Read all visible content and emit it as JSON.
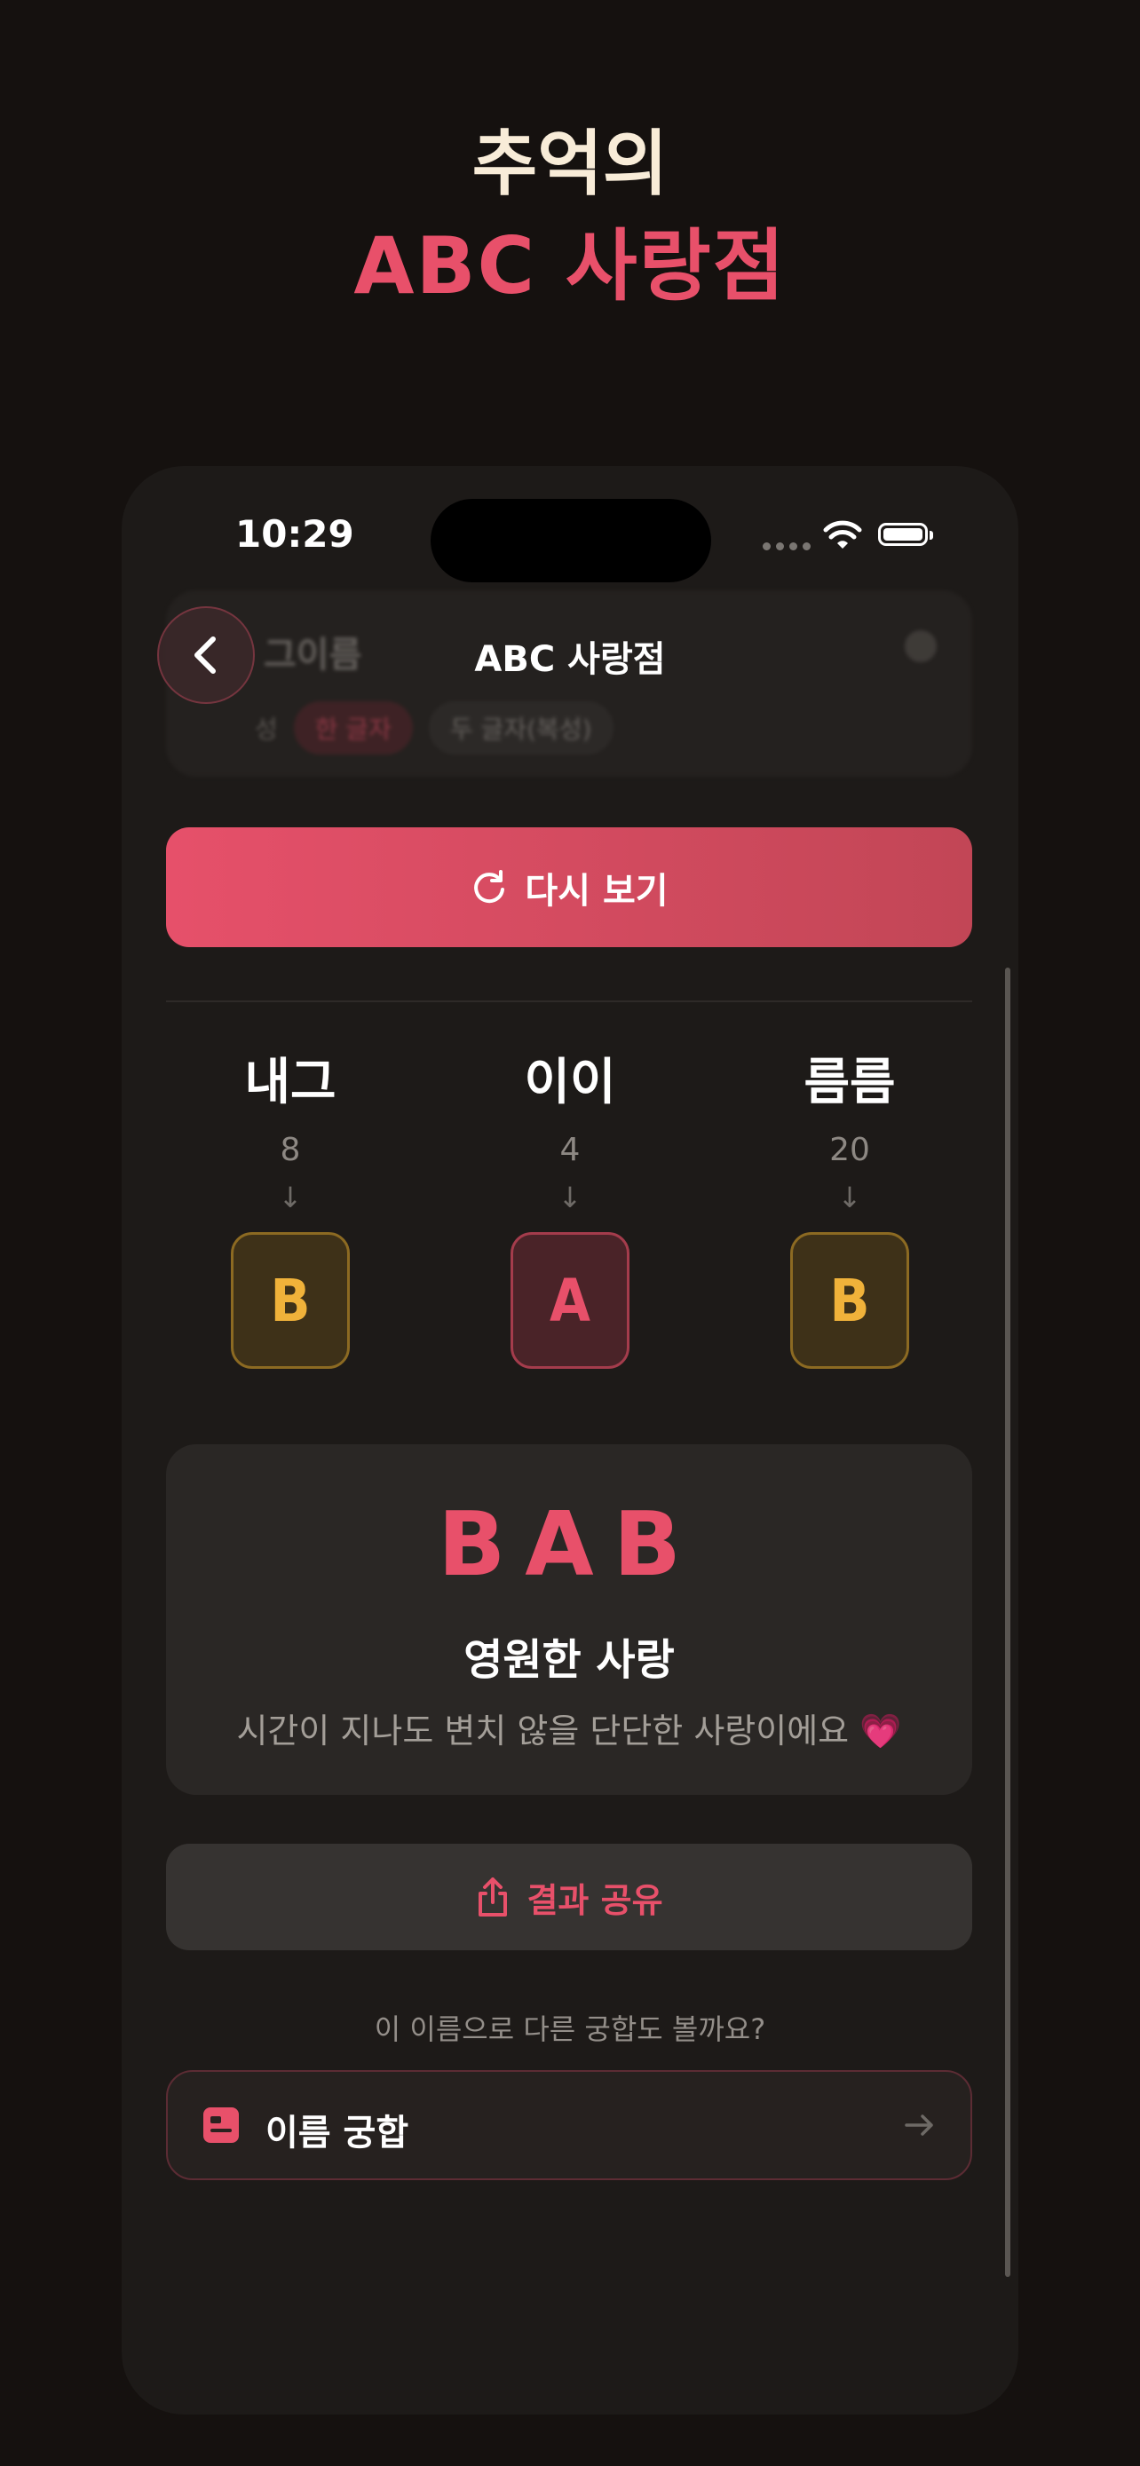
{
  "hero": {
    "line1": "추억의",
    "line2": "ABC 사랑점"
  },
  "status_bar": {
    "time": "10:29"
  },
  "background_card": {
    "title": "그이름",
    "label": "성",
    "chip_one": "한 글자",
    "chip_two": "두 글자(복성)"
  },
  "nav": {
    "title": "ABC 사랑점"
  },
  "retry": {
    "label": "다시 보기"
  },
  "columns": [
    {
      "name": "내그",
      "number": "8",
      "grade": "B"
    },
    {
      "name": "이이",
      "number": "4",
      "grade": "A"
    },
    {
      "name": "름름",
      "number": "20",
      "grade": "B"
    }
  ],
  "arrow_glyph": "↓",
  "result": {
    "code": "BAB",
    "title": "영원한 사랑",
    "description": "시간이 지나도 변치 않을 단단한 사랑이에요 💗"
  },
  "share": {
    "label": "결과 공유"
  },
  "prompt": "이 이름으로 다른 궁합도 볼까요?",
  "compat": {
    "label": "이름 궁합"
  },
  "colors": {
    "accent": "#e8506a",
    "grade_b": "#f0b23a",
    "background": "#15110f"
  },
  "icons": [
    "back-chevron-icon",
    "refresh-icon",
    "share-icon",
    "name-card-icon",
    "arrow-right-icon",
    "wifi-icon",
    "battery-icon"
  ]
}
